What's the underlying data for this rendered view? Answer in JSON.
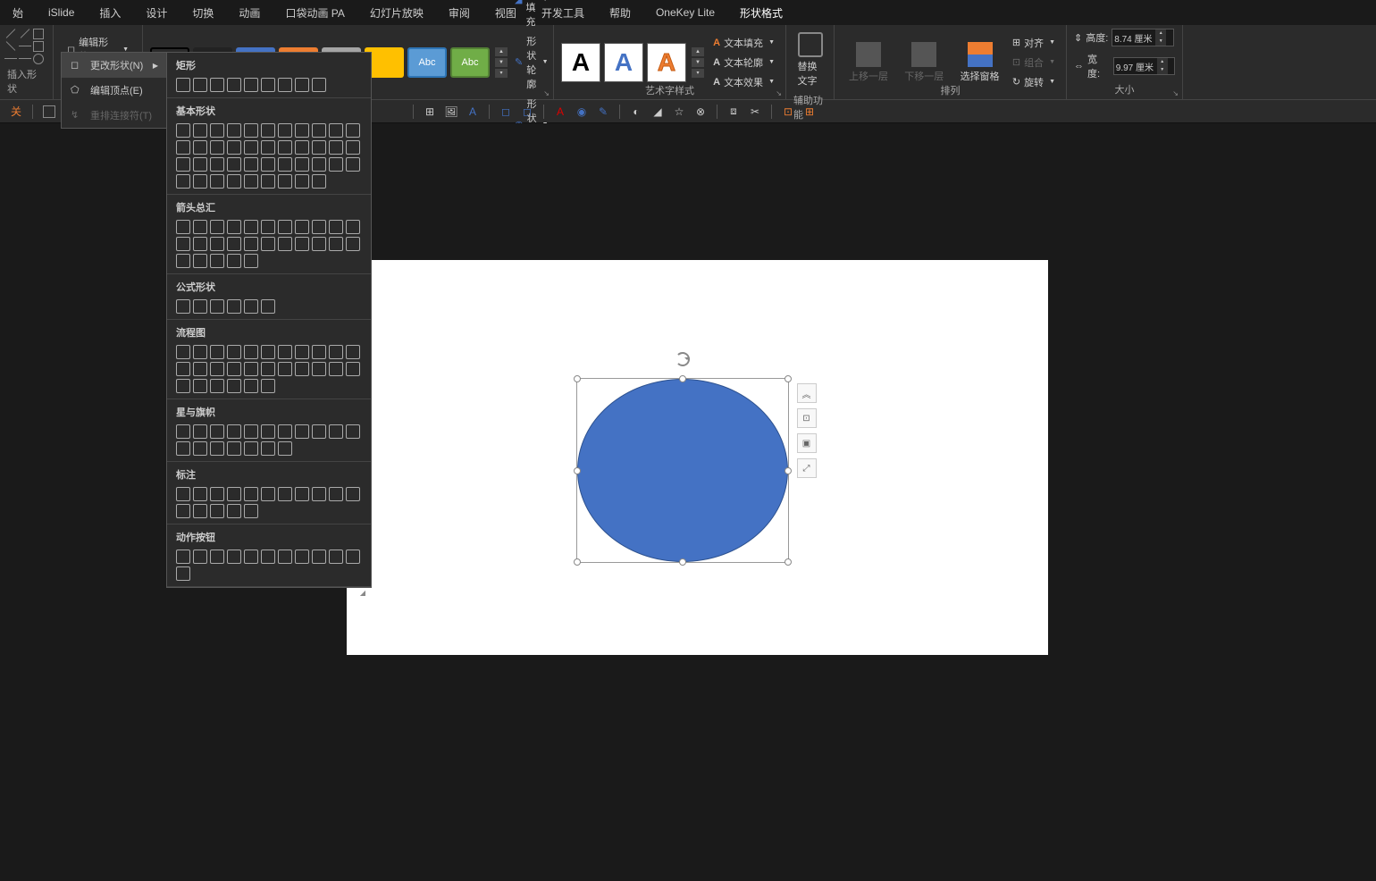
{
  "tabs": {
    "start": "始",
    "islide": "iSlide",
    "insert": "插入",
    "design": "设计",
    "transition": "切换",
    "animation": "动画",
    "pocket": "口袋动画 PA",
    "slideshow": "幻灯片放映",
    "review": "审阅",
    "view": "视图",
    "devtools": "开发工具",
    "help": "帮助",
    "onekey": "OneKey Lite",
    "shapeformat": "形状格式"
  },
  "ribbon": {
    "editshape": "编辑形状",
    "insertshape_label": "插入形状",
    "fill": "形状填充",
    "outline": "形状轮廓",
    "effects": "形状效果",
    "textfill": "文本填充",
    "textoutline": "文本轮廓",
    "texteffects": "文本效果",
    "wordart_label": "艺术字样式",
    "altchg": "替换文字",
    "accessibility_label": "辅助功能",
    "bringfwd": "上移一层",
    "sendback": "下移一层",
    "selectpane": "选择窗格",
    "align": "对齐",
    "group": "组合",
    "rotate": "旋转",
    "arrange_label": "排列",
    "height": "高度:",
    "width": "宽度:",
    "height_val": "8.74 厘米",
    "width_val": "9.97 厘米",
    "size_label": "大小"
  },
  "preset_label": "Abc",
  "context_menu": {
    "change_shape": "更改形状(N)",
    "edit_points": "编辑顶点(E)",
    "reroute": "重排连接符(T)"
  },
  "gallery": {
    "rect": "矩形",
    "basic": "基本形状",
    "arrows": "箭头总汇",
    "formula": "公式形状",
    "flowchart": "流程图",
    "stars": "星与旗帜",
    "callouts": "标注",
    "actions": "动作按钮"
  },
  "float": {
    "collapse": "︽"
  }
}
